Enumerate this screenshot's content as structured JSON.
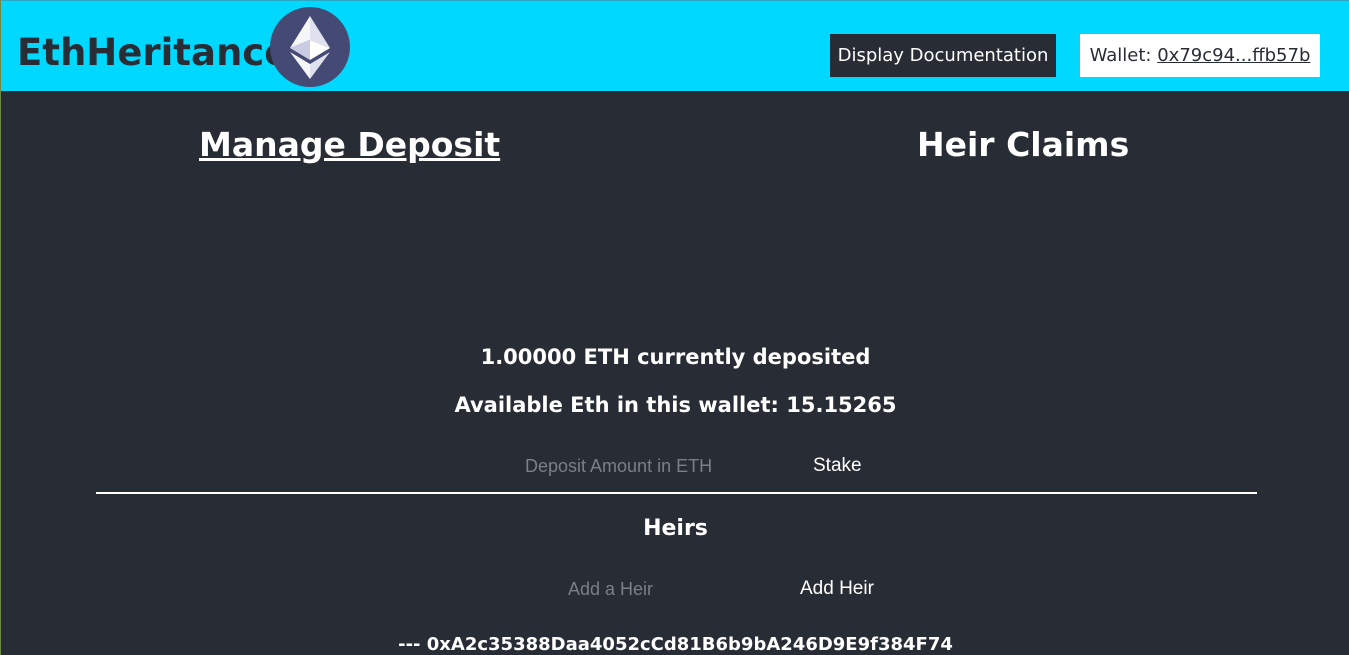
{
  "header": {
    "brand": "EthHeritance",
    "logo_icon": "ethereum-icon",
    "doc_button": "Display Documentation",
    "wallet_label": "Wallet: ",
    "wallet_address": "0x79c94...ffb57b"
  },
  "tabs": {
    "manage": "Manage Deposit",
    "heir": "Heir Claims"
  },
  "deposit": {
    "current": "1.00000 ETH currently deposited",
    "available": "Available Eth in this wallet: 15.15265",
    "input_placeholder": "Deposit Amount in ETH",
    "stake_label": "Stake"
  },
  "heirs": {
    "title": "Heirs",
    "input_placeholder": "Add a Heir",
    "add_label": "Add Heir",
    "entries": [
      "--- 0xA2c35388Daa4052cCd81B6b9bA246D9E9f384F74"
    ]
  },
  "colors": {
    "header_bg": "#00d8ff",
    "page_bg": "#282c34",
    "logo_bg": "#454a75"
  }
}
